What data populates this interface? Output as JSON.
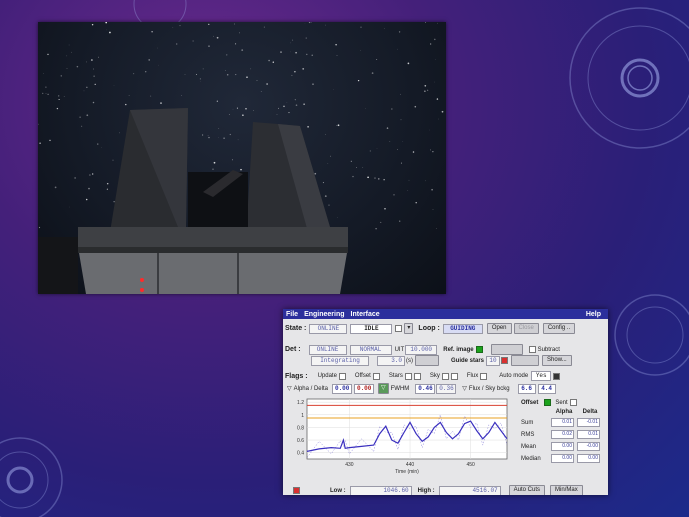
{
  "screen": {
    "menu": [
      "File",
      "Engineering",
      "Interface"
    ],
    "menu_help": "Help",
    "state": {
      "label": "State :",
      "online": "ONLINE",
      "idle": "IDLE",
      "loop_label": "Loop :",
      "guiding": "GUIDING",
      "open": "Open",
      "close": "Close",
      "config": "Config .."
    },
    "det": {
      "label": "Det :",
      "online": "ONLINE",
      "normal": "NORMAL",
      "uit_label": "UIT",
      "uit_value": "10.000",
      "integrating": "Integrating",
      "seconds_value": "3.0",
      "seconds_unit": "(s)",
      "ref_image": "Ref. image",
      "subtract": "Subtract",
      "guide_stars_label": "Guide stars",
      "guide_stars_value": "10",
      "show": "Show..."
    },
    "flags": {
      "label": "Flags :",
      "update": "Update",
      "offset": "Offset",
      "stars": "Stars",
      "sky": "Sky",
      "flux": "Flux",
      "auto_mode": "Auto mode",
      "yes": "Yes",
      "alpha_delta": "Alpha / Delta",
      "alpha_value": "0.00",
      "delta_value": "0.00",
      "fwhm": "FWHM",
      "fwhm_1": "0.46",
      "fwhm_2": "0.36",
      "flux_sky": "Flux / Sky bckg",
      "flux_value": "6.6",
      "sky_value": "4.4"
    },
    "offset_panel": {
      "title": "Offset",
      "sent": "Sent",
      "col_alpha": "Alpha",
      "col_delta": "Delta",
      "rows": [
        {
          "label": "Sum",
          "alpha": "0.01",
          "delta": "-0.01"
        },
        {
          "label": "RMS",
          "alpha": "0.02",
          "delta": "0.01"
        },
        {
          "label": "Mean",
          "alpha": "0.00",
          "delta": "-0.00"
        },
        {
          "label": "Median",
          "alpha": "0.00",
          "delta": "0.00"
        }
      ]
    },
    "plot": {
      "y_ticks": [
        "1.2",
        "1",
        "0.8",
        "0.6",
        "0.4"
      ],
      "x_ticks": [
        "430",
        "440",
        "450"
      ],
      "xlabel": "Time (min)"
    },
    "bottom": {
      "low_label": "Low :",
      "low_value": "1046.60",
      "high_label": "High :",
      "high_value": "4516.07",
      "auto_cuts": "Auto Cuts",
      "min_max": "Min/Max"
    }
  },
  "chart_data": {
    "type": "line",
    "x_range": [
      423,
      456
    ],
    "ylim": [
      0.3,
      1.25
    ],
    "x_ticks": [
      "430",
      "440",
      "450"
    ],
    "y_ticks": [
      "1.2",
      "1",
      "0.8",
      "0.6",
      "0.4"
    ],
    "xlabel": "Time (min)",
    "reference_lines": [
      {
        "y": 1.15,
        "color": "#d84030"
      },
      {
        "y": 0.95,
        "color": "#e8a020"
      }
    ],
    "series": [
      {
        "color": "#3a2fbf",
        "x": [
          423,
          425,
          427,
          428.5,
          429,
          429.3,
          430,
          432,
          434,
          435,
          436,
          437,
          438,
          439,
          440,
          441,
          442,
          443,
          444,
          445,
          446,
          447,
          448,
          449,
          450,
          451,
          452,
          453,
          454,
          455,
          456
        ],
        "values": [
          0.42,
          0.46,
          0.48,
          0.47,
          0.6,
          0.47,
          0.48,
          0.5,
          0.52,
          0.7,
          0.82,
          0.6,
          0.55,
          0.72,
          0.88,
          0.7,
          0.58,
          0.65,
          0.8,
          0.88,
          0.72,
          0.62,
          0.7,
          0.86,
          0.9,
          0.75,
          0.62,
          0.72,
          0.88,
          0.75,
          0.62
        ]
      }
    ]
  }
}
